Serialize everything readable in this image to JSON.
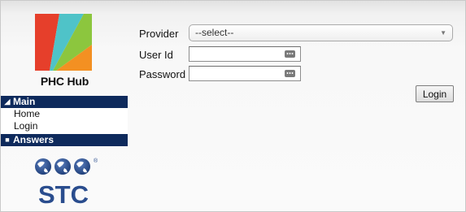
{
  "sidebar": {
    "app_name": "PHC Hub",
    "sections": [
      {
        "title": "Main",
        "expanded": true,
        "items": [
          "Home",
          "Login"
        ]
      },
      {
        "title": "Answers",
        "expanded": false,
        "items": []
      }
    ],
    "vendor_logo_text": "STC",
    "vendor_logo_mark": "®"
  },
  "form": {
    "provider_label": "Provider",
    "provider_value": "--select--",
    "userid_label": "User Id",
    "userid_value": "",
    "password_label": "Password",
    "password_value": "",
    "login_label": "Login"
  },
  "colors": {
    "nav_header": "#0e2a5c",
    "logo_red": "#e63f2b",
    "logo_teal": "#4fc3c8",
    "logo_green": "#8cc63e",
    "logo_orange": "#f39022",
    "stc_blue": "#2a4d8e"
  },
  "icons": {
    "section_expanded": "collapse-triangle-icon",
    "section_collapsed": "square-bullet-icon",
    "field_keyboard": "keyboard-icon",
    "dropdown": "dropdown-caret-icon"
  }
}
